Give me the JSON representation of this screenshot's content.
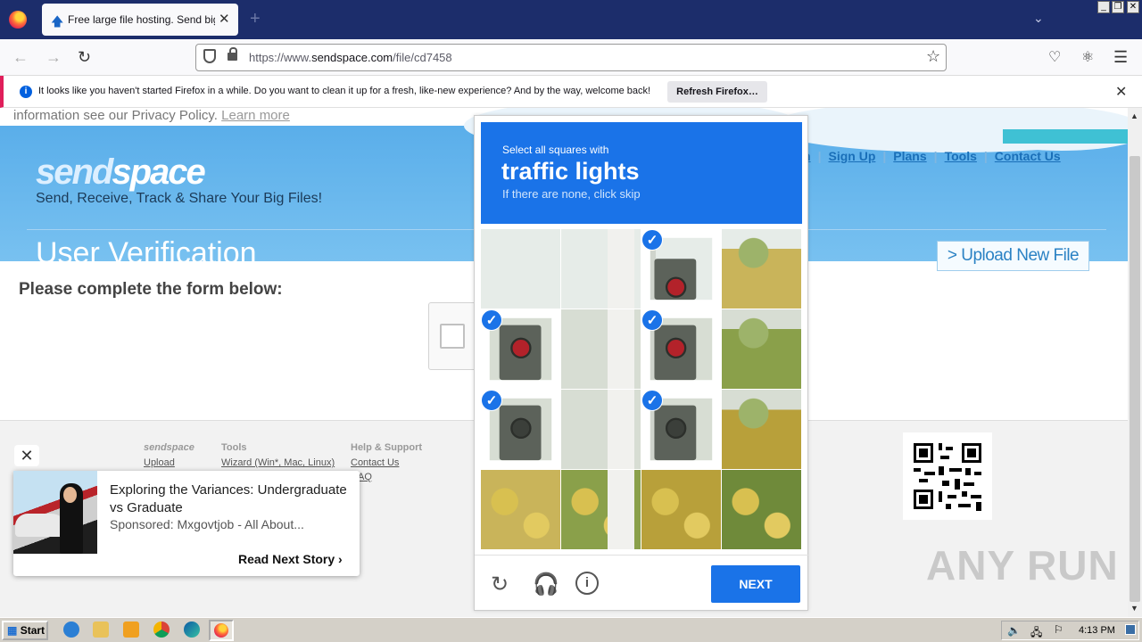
{
  "browser": {
    "tab_title": "Free large file hosting. Send big file",
    "new_tab": "+",
    "url_prefix": "https://www.",
    "url_domain": "sendspace.com",
    "url_path": "/file/cd7458"
  },
  "notification": {
    "message": "It looks like you haven't started Firefox in a while. Do you want to clean it up for a fresh, like-new experience? And by the way, welcome back!",
    "button": "Refresh Firefox…"
  },
  "page": {
    "cookie_text": "information see our Privacy Policy.",
    "learn_more": "Learn more",
    "logo_a": "send",
    "logo_b": "space",
    "tagline": "Send, Receive, Track & Share Your Big Files!",
    "title": "User Verification",
    "nav": {
      "partial": "n",
      "signup": "Sign Up",
      "plans": "Plans",
      "tools": "Tools",
      "contact": "Contact Us"
    },
    "upload_button": "> Upload New File",
    "prompt": "Please complete the form below:",
    "footer": {
      "col1_title": "sendspace",
      "col1_link": "Upload",
      "col2_title": "Tools",
      "col2_link": "Wizard (Win*, Mac, Linux)",
      "col3_title": "Help & Support",
      "col3_link1": "Contact Us",
      "col3_link2": "AQ"
    }
  },
  "ad": {
    "title": "Exploring the Variances: Undergraduate vs Graduate",
    "sponsor": "Sponsored: Mxgovtjob - All About...",
    "cta": "Read Next Story"
  },
  "captcha": {
    "select_all": "Select all squares with",
    "object": "traffic lights",
    "skip_hint": "If there are none, click skip",
    "next": "NEXT",
    "selected_tiles": [
      2,
      4,
      6,
      8,
      10
    ]
  },
  "watermark": "ANY RUN",
  "taskbar": {
    "start": "Start",
    "clock": "4:13 PM"
  }
}
